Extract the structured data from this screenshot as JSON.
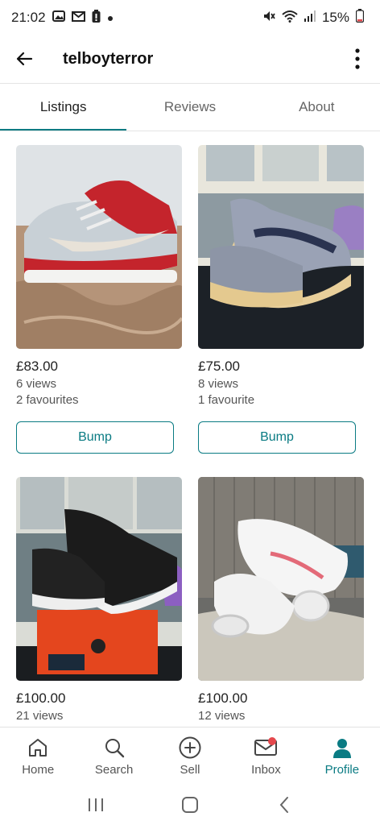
{
  "status_bar": {
    "time": "21:02",
    "battery": "15%",
    "icons": [
      "gallery-icon",
      "gmail-icon",
      "battery-alert-icon",
      "dot-icon",
      "mute-icon",
      "wifi-icon",
      "signal-icon"
    ]
  },
  "header": {
    "back_icon": "arrow-left-icon",
    "username": "telboyterror",
    "menu_icon": "more-vertical-icon"
  },
  "tabs": [
    {
      "label": "Listings",
      "active": true
    },
    {
      "label": "Reviews",
      "active": false
    },
    {
      "label": "About",
      "active": false
    }
  ],
  "listings": [
    {
      "price": "£83.00",
      "views": "6 views",
      "favourites": "2 favourites",
      "bump_label": "Bump"
    },
    {
      "price": "£75.00",
      "views": "8 views",
      "favourites": "1 favourite",
      "bump_label": "Bump"
    },
    {
      "price": "£100.00",
      "views": "21 views"
    },
    {
      "price": "£100.00",
      "views": "12 views"
    }
  ],
  "bottom_nav": [
    {
      "label": "Home",
      "icon": "home-icon",
      "active": false
    },
    {
      "label": "Search",
      "icon": "search-icon",
      "active": false
    },
    {
      "label": "Sell",
      "icon": "plus-circle-icon",
      "active": false
    },
    {
      "label": "Inbox",
      "icon": "mail-icon",
      "active": false,
      "badge": true
    },
    {
      "label": "Profile",
      "icon": "person-icon",
      "active": true
    }
  ],
  "colors": {
    "accent": "#0a7b83",
    "badge": "#e5484d"
  }
}
